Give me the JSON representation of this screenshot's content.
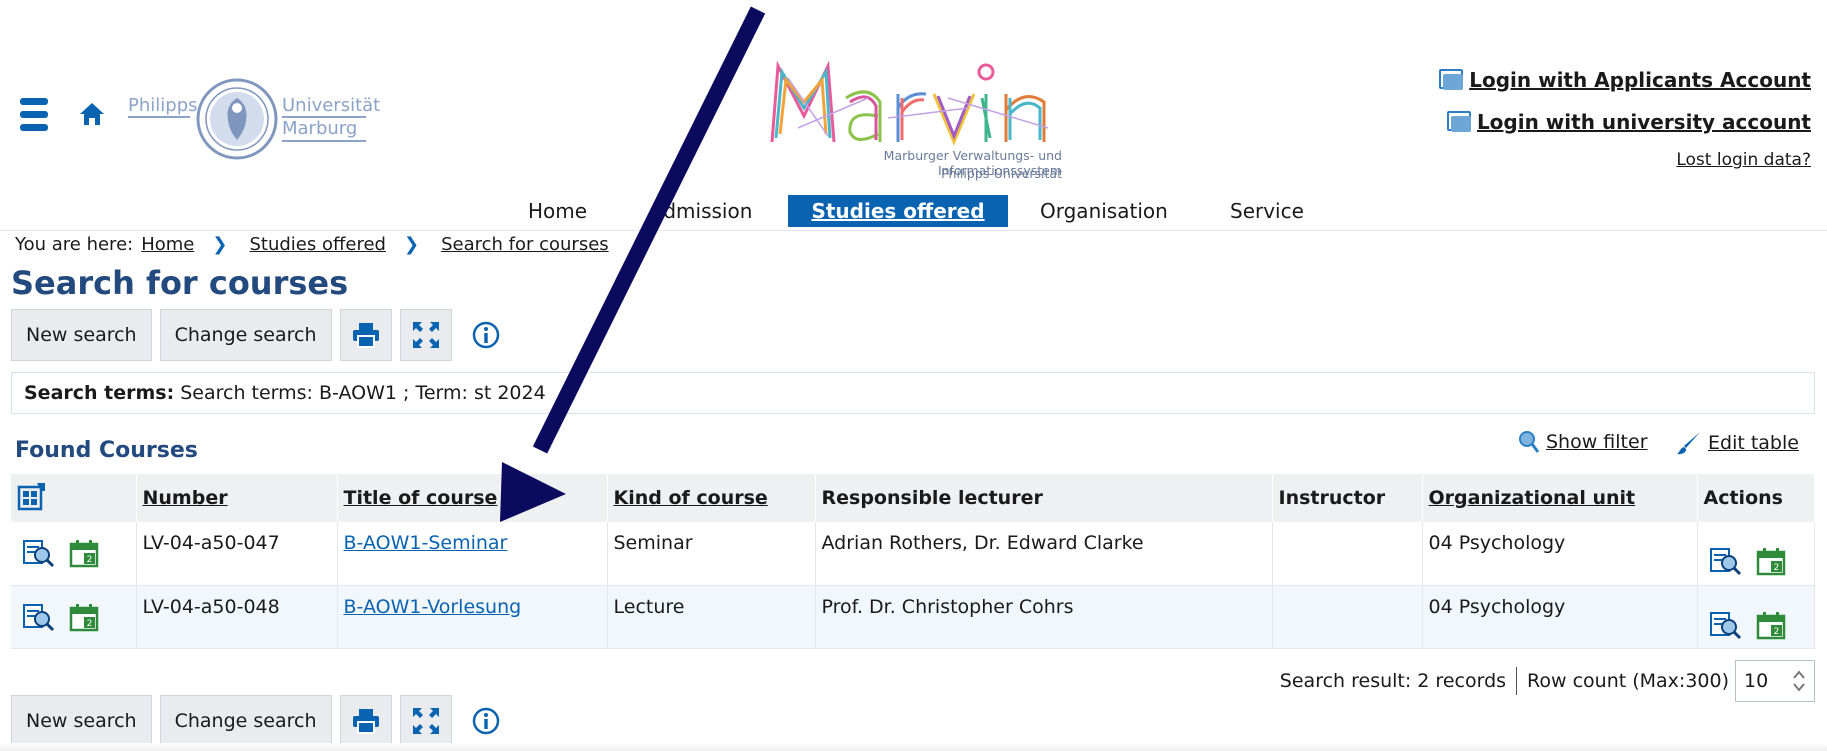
{
  "header": {
    "university": {
      "left": "Philipps",
      "right_top": "Universität",
      "right_bottom": "Marburg"
    },
    "app_title": "Marvin",
    "app_subtitle_1": "Marburger Verwaltungs- und Informationssystem",
    "app_subtitle_2": "Philipps-Universität",
    "login_applicants": "Login with Applicants Account",
    "login_university": "Login with university account",
    "lost_login": "Lost login data?"
  },
  "nav": {
    "items": [
      {
        "label": "Home"
      },
      {
        "label": "Admission"
      },
      {
        "label": "Studies offered"
      },
      {
        "label": "Organisation"
      },
      {
        "label": "Service"
      }
    ]
  },
  "breadcrumb": {
    "label": "You are here:",
    "items": [
      "Home",
      "Studies offered",
      "Search for courses"
    ]
  },
  "page_title": "Search for courses",
  "toolbar": {
    "new_search": "New search",
    "change_search": "Change search"
  },
  "search_terms": {
    "label": "Search terms:",
    "value": "Search terms: B-AOW1 ;  Term: st 2024"
  },
  "results": {
    "title": "Found Courses",
    "show_filter": "Show filter",
    "edit_table": "Edit table",
    "columns": [
      "Number",
      "Title of course",
      "Kind of course",
      "Responsible lecturer",
      "Instructor",
      "Organizational unit",
      "Actions"
    ],
    "rows": [
      {
        "number": "LV-04-a50-047",
        "title": "B-AOW1-Seminar",
        "kind": "Seminar",
        "lecturer": "Adrian Rothers, Dr. Edward Clarke",
        "instructor": "",
        "unit": "04 Psychology"
      },
      {
        "number": "LV-04-a50-048",
        "title": "B-AOW1-Vorlesung",
        "kind": "Lecture",
        "lecturer": "Prof. Dr. Christopher Cohrs",
        "instructor": "",
        "unit": "04 Psychology"
      }
    ],
    "search_result": "Search result: 2 records",
    "row_count_label": "Row count (Max:300)",
    "row_count_value": "10"
  },
  "colors": {
    "accent": "#0a63b1",
    "title": "#234a7e",
    "arrow": "#0a0a5e"
  }
}
